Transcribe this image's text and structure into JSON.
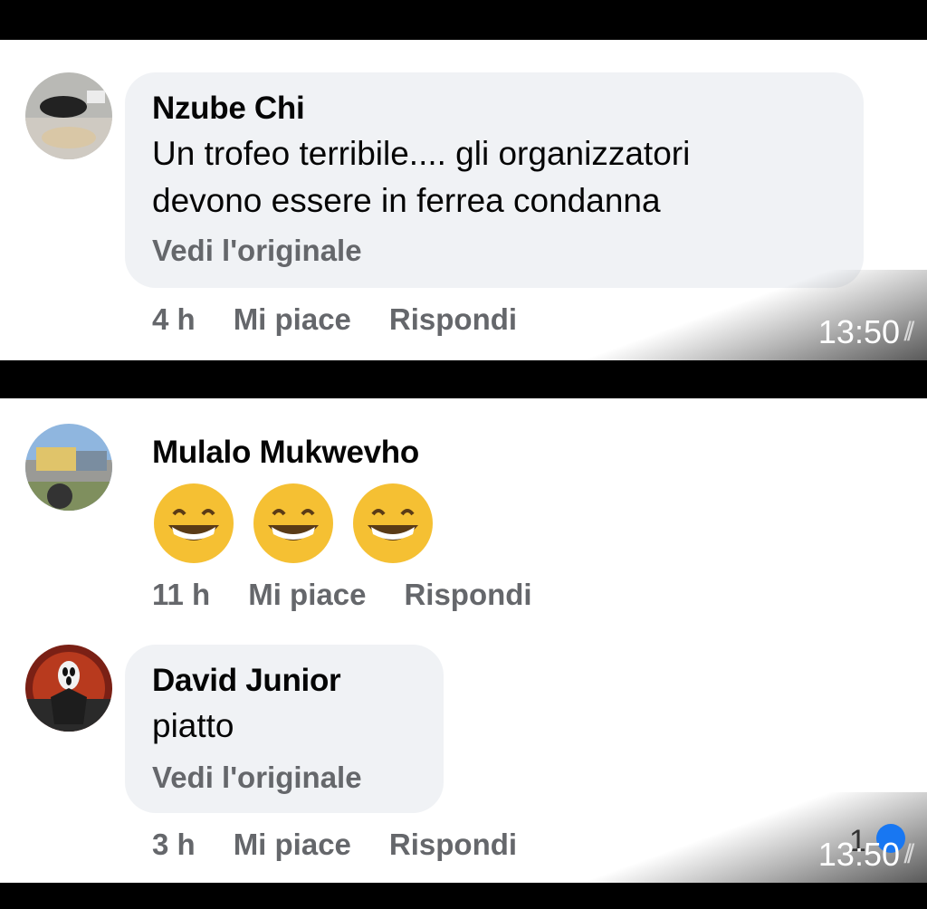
{
  "comments": [
    {
      "author": "Nzube Chi",
      "text_line1": "Un trofeo terribile.... gli organizzatori",
      "text_line2": "devono essere in ferrea condanna",
      "see_original": "Vedi l'originale",
      "time": "4 h",
      "like": "Mi piace",
      "reply": "Rispondi",
      "stamp": "13:50"
    },
    {
      "author": "Mulalo Mukwevho",
      "emoji_name": "grinning-face-icon",
      "emoji_count": 3,
      "time": "11 h",
      "like": "Mi piace",
      "reply": "Rispondi"
    },
    {
      "author": "David Junior",
      "text_line1": "piatto",
      "see_original": "Vedi l'originale",
      "time": "3 h",
      "like": "Mi piace",
      "reply": "Rispondi",
      "reaction_count": "1",
      "stamp": "13:50"
    }
  ],
  "colors": {
    "bubble": "#f0f2f5",
    "secondary_text": "#65676b",
    "primary_text": "#050505",
    "reaction_blue": "#1877f2"
  }
}
